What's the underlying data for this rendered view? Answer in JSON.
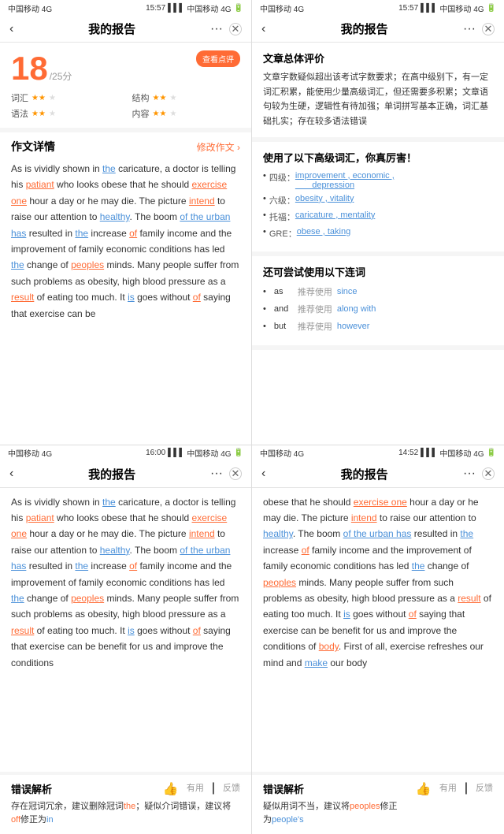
{
  "phones": {
    "phone1": {
      "statusBar": {
        "carrier": "中国移动 4G",
        "time": "15:57",
        "carrierRight": "中国移动 4G"
      },
      "navTitle": "我的报告",
      "navDots": "···",
      "scoreCard": {
        "reviewBtnLabel": "查看点评",
        "score": "18",
        "total": "/25分",
        "items": [
          {
            "label": "词汇",
            "stars": 2
          },
          {
            "label": "结构",
            "stars": 2
          },
          {
            "label": "语法",
            "stars": 2
          },
          {
            "label": "内容",
            "stars": 2
          }
        ]
      },
      "essaySection": {
        "title": "作文详情",
        "action": "修改作文 ›",
        "text": "As is vividly shown in the caricature, a doctor is telling his patiant who looks obese that he should exercise one hour a day or he may die. The picture intend to raise our attention to healthy. The boom of the urban has resulted in the increase of family income and the improvement of family economic conditions has led the change of peoples minds. Many people suffer from such problems as obesity, high blood pressure as a result of eating too much. It is goes without of saying that exercise can be"
      }
    },
    "phone2": {
      "statusBar": {
        "carrier": "中国移动 4G",
        "time": "15:57",
        "carrierRight": "中国移动 4G"
      },
      "navTitle": "我的报告",
      "overallSection": {
        "title": "文章总体评价",
        "text": "文章字数疑似超出该考试字数要求；在高中级别下，有一定词汇积累，能使用少量高级词汇，但还需要多积累；文章语句较为生硬，逻辑性有待加强；单词拼写基本正确，词汇基础扎实；存在较多语法错误"
      },
      "vocabSection": {
        "title": "使用了以下高级词汇，你真厉害！",
        "items": [
          {
            "level": "四级：",
            "words": "improvement , economic ,\n          depression"
          },
          {
            "level": "六级：",
            "words": "obesity , vitality"
          },
          {
            "level": "托福：",
            "words": "caricature , mentality"
          },
          {
            "level": "GRE：",
            "words": "obese , taking"
          }
        ]
      },
      "connectorSection": {
        "title": "还可尝试使用以下连词",
        "items": [
          {
            "word": "as",
            "recommend": "推荐使用",
            "target": "since"
          },
          {
            "word": "and",
            "recommend": "推荐使用",
            "target": "along with"
          },
          {
            "word": "but",
            "recommend": "推荐使用",
            "target": "however"
          }
        ]
      }
    },
    "phone3": {
      "statusBar": {
        "carrier": "中国移动 4G",
        "time": "16:00",
        "carrierRight": "中国移动 4G"
      },
      "navTitle": "我的报告",
      "essayText": "As is vividly shown in the caricature, a doctor is telling his patiant who looks obese that he should exercise one hour a day or he may die. The picture intend to raise our attention to healthy. The boom of the urban has resulted in the increase of family income and the improvement of family economic conditions has led the change of peoples minds. Many people suffer from such problems as obesity, high blood pressure as a result of eating too much. It is goes without of saying that exercise can be benefit for us and improve the conditions",
      "errorSection": {
        "title": "错误解析",
        "useful": "有用",
        "feedback": "反馈",
        "text": "存在冠词冗余，建议删除冠词the；疑似介词错误，建议将off修正为in"
      }
    },
    "phone4": {
      "statusBar": {
        "carrier": "中国移动 4G",
        "time": "14:52",
        "carrierRight": "中国移动 4G"
      },
      "navTitle": "我的报告",
      "essayText": "obese that he should exercise one hour a day or he may die. The picture intend to raise our attention to healthy. The boom of the urban has resulted in the increase of family income and the improvement of family economic conditions has led the change of peoples minds. Many people suffer from such problems as obesity, high blood pressure as a result of eating too much. It is goes without of saying that exercise can be benefit for us and improve the conditions of body. First of all, exercise refreshes our mind and make our body",
      "errorSection": {
        "title": "错误解析",
        "useful": "有用",
        "feedback": "反馈",
        "text": "疑似用词不当，建议将peoples修正为people's"
      }
    }
  }
}
